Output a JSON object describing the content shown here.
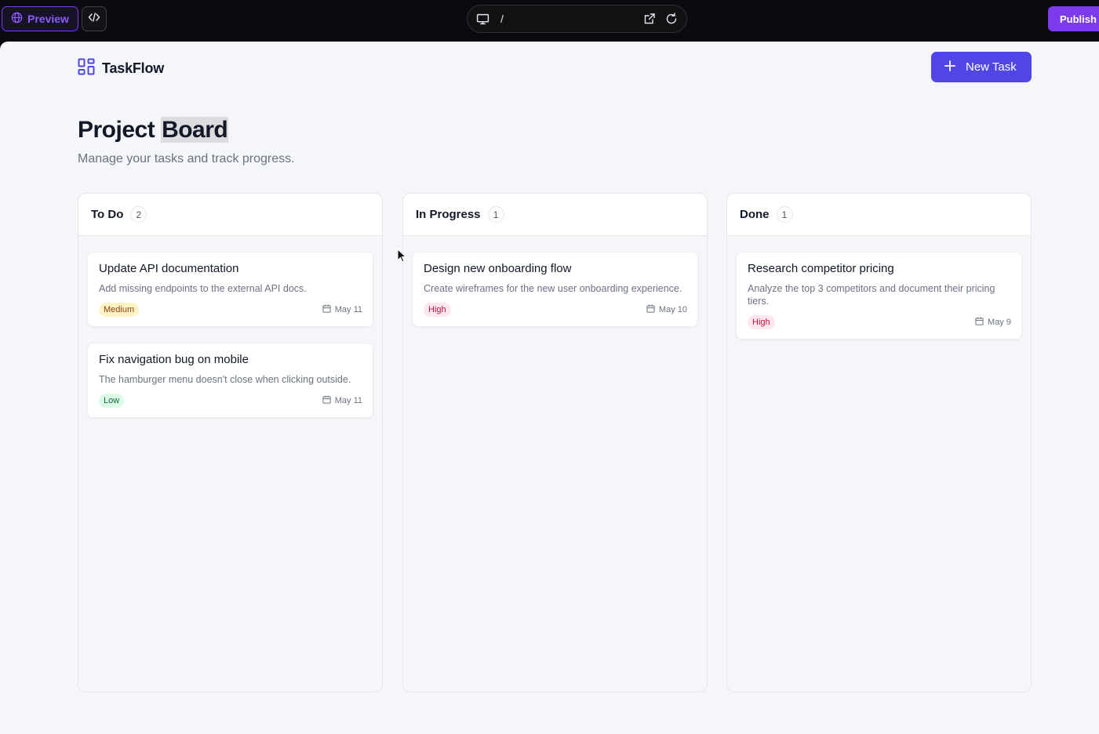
{
  "topbar": {
    "preview_label": "Preview",
    "url_path": "/",
    "publish_label": "Publish"
  },
  "app": {
    "name": "TaskFlow",
    "new_task_label": "New Task",
    "title_part1": "Project",
    "title_part2": "Board",
    "subtitle": "Manage your tasks and track progress."
  },
  "columns": [
    {
      "title": "To Do",
      "count": "2",
      "cards": [
        {
          "title": "Update API documentation",
          "desc": "Add missing endpoints to the external API docs.",
          "priority": "Medium",
          "date": "May 11"
        },
        {
          "title": "Fix navigation bug on mobile",
          "desc": "The hamburger menu doesn't close when clicking outside.",
          "priority": "Low",
          "date": "May 11"
        }
      ]
    },
    {
      "title": "In Progress",
      "count": "1",
      "cards": [
        {
          "title": "Design new onboarding flow",
          "desc": "Create wireframes for the new user onboarding experience.",
          "priority": "High",
          "date": "May 10"
        }
      ]
    },
    {
      "title": "Done",
      "count": "1",
      "cards": [
        {
          "title": "Research competitor pricing",
          "desc": "Analyze the top 3 competitors and document their pricing tiers.",
          "priority": "High",
          "date": "May 9"
        }
      ]
    }
  ],
  "colors": {
    "accent": "#4f46e5",
    "publish": "#7c3aed",
    "priority_medium": "#fef3c7",
    "priority_low": "#dcfce7",
    "priority_high": "#fce7ec"
  }
}
